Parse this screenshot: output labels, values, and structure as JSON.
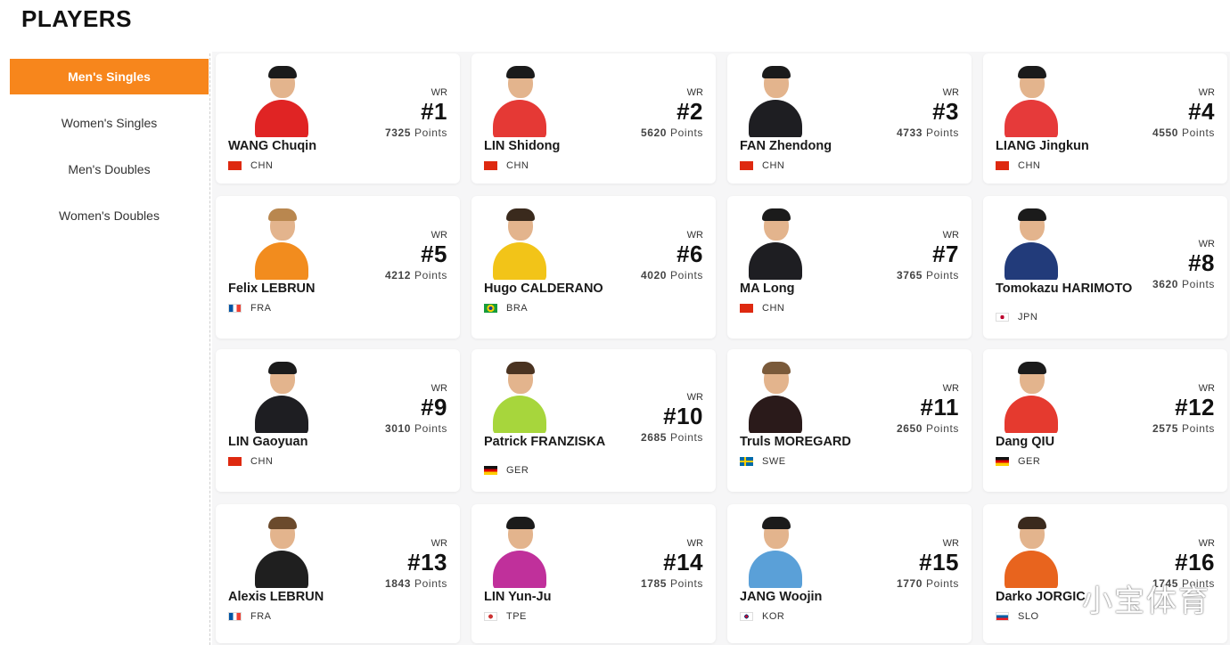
{
  "page_title": "PLAYERS",
  "sidebar": {
    "items": [
      {
        "label": "Men's Singles",
        "active": true
      },
      {
        "label": "Women's Singles",
        "active": false
      },
      {
        "label": "Men's Doubles",
        "active": false
      },
      {
        "label": "Women's Doubles",
        "active": false
      }
    ]
  },
  "wr_label": "WR",
  "points_label": "Points",
  "players": [
    {
      "rank": "#1",
      "name": "WANG Chuqin",
      "points": "7325",
      "country": "CHN",
      "shirt": "#e02424",
      "hair": "#1b1b1b"
    },
    {
      "rank": "#2",
      "name": "LIN Shidong",
      "points": "5620",
      "country": "CHN",
      "shirt": "#e53935",
      "hair": "#1b1b1b"
    },
    {
      "rank": "#3",
      "name": "FAN Zhendong",
      "points": "4733",
      "country": "CHN",
      "shirt": "#1e1e22",
      "hair": "#1b1b1b"
    },
    {
      "rank": "#4",
      "name": "LIANG Jingkun",
      "points": "4550",
      "country": "CHN",
      "shirt": "#e63a3a",
      "hair": "#1b1b1b"
    },
    {
      "rank": "#5",
      "name": "Felix LEBRUN",
      "points": "4212",
      "country": "FRA",
      "shirt": "#f28c1e",
      "hair": "#b9874f"
    },
    {
      "rank": "#6",
      "name": "Hugo CALDERANO",
      "points": "4020",
      "country": "BRA",
      "shirt": "#f2c418",
      "hair": "#3a2a1d"
    },
    {
      "rank": "#7",
      "name": "MA Long",
      "points": "3765",
      "country": "CHN",
      "shirt": "#1e1e22",
      "hair": "#1b1b1b"
    },
    {
      "rank": "#8",
      "name": "Tomokazu HARIMOTO",
      "points": "3620",
      "country": "JPN",
      "shirt": "#223b7a",
      "hair": "#1b1b1b"
    },
    {
      "rank": "#9",
      "name": "LIN Gaoyuan",
      "points": "3010",
      "country": "CHN",
      "shirt": "#1e1e22",
      "hair": "#1b1b1b"
    },
    {
      "rank": "#10",
      "name": "Patrick FRANZISKA",
      "points": "2685",
      "country": "GER",
      "shirt": "#a7d63c",
      "hair": "#4a3321"
    },
    {
      "rank": "#11",
      "name": "Truls MOREGARD",
      "points": "2650",
      "country": "SWE",
      "shirt": "#2a1a1a",
      "hair": "#7a5a3a"
    },
    {
      "rank": "#12",
      "name": "Dang QIU",
      "points": "2575",
      "country": "GER",
      "shirt": "#e53a2f",
      "hair": "#1b1b1b"
    },
    {
      "rank": "#13",
      "name": "Alexis LEBRUN",
      "points": "1843",
      "country": "FRA",
      "shirt": "#1f1f1f",
      "hair": "#6b4a2c"
    },
    {
      "rank": "#14",
      "name": "LIN Yun-Ju",
      "points": "1785",
      "country": "TPE",
      "shirt": "#c0309b",
      "hair": "#1b1b1b"
    },
    {
      "rank": "#15",
      "name": "JANG Woojin",
      "points": "1770",
      "country": "KOR",
      "shirt": "#5aa0d8",
      "hair": "#1b1b1b"
    },
    {
      "rank": "#16",
      "name": "Darko JORGIC",
      "points": "1745",
      "country": "SLO",
      "shirt": "#e8641e",
      "hair": "#3a2a1d"
    }
  ],
  "watermark": "小宝体育"
}
